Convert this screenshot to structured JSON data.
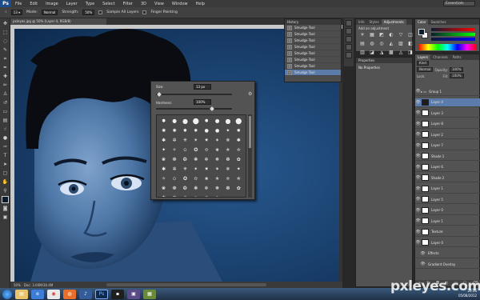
{
  "app": {
    "logo": "Ps"
  },
  "menu": [
    "File",
    "Edit",
    "Image",
    "Layer",
    "Type",
    "Select",
    "Filter",
    "3D",
    "View",
    "Window",
    "Help"
  ],
  "workspace": "Essentials",
  "options_bar": {
    "mode_label": "Mode:",
    "mode_value": "Normal",
    "strength_label": "Strength:",
    "strength_value": "50%",
    "sample_all": "Sample All Layers",
    "finger_painting": "Finger Painting"
  },
  "document": {
    "tab_title": "pxleyes.jpg @ 50% (Layer 4, RGB/8)",
    "zoom": "50%",
    "doc_info": "Doc: 3.00M/30.4M"
  },
  "brush_popup": {
    "size_label": "Size:",
    "size_value": "13 px",
    "hardness_label": "Hardness:",
    "hardness_value": "100%"
  },
  "brush_presets": [
    "●",
    "●",
    "●",
    "●",
    "●",
    "●",
    "●",
    "●",
    "✺",
    "✺",
    "✹",
    "✸",
    "●",
    "●",
    "✦",
    "✹",
    "✱",
    "✲",
    "✳",
    "✴",
    "✷",
    "✶",
    "✵",
    "✱",
    "✦",
    "✧",
    "✩",
    "✪",
    "✫",
    "✬",
    "✭",
    "✮",
    "❀",
    "❁",
    "❂",
    "❃",
    "❄",
    "❅",
    "❆",
    "✿",
    "✱",
    "✲",
    "✳",
    "✴",
    "✷",
    "✶",
    "✵",
    "✦",
    "✧",
    "✩",
    "✪",
    "✫",
    "✬",
    "✭",
    "✮",
    "✯",
    "❀",
    "❁",
    "❂",
    "❃",
    "❄",
    "❅",
    "❆",
    "✿",
    "✱",
    "✲",
    "✳",
    "✴",
    "✷",
    "✶"
  ],
  "history": {
    "title": "History",
    "items": [
      "Smudge Tool",
      "Smudge Tool",
      "Smudge Tool",
      "Smudge Tool",
      "Smudge Tool",
      "Smudge Tool",
      "Smudge Tool",
      "Smudge Tool"
    ]
  },
  "adjustments": {
    "tabs": [
      "Info",
      "Styles",
      "Adjustments"
    ],
    "title": "Add an adjustment",
    "icons": [
      "☀",
      "▦",
      "◩",
      "◐",
      "▽",
      "◫",
      "▤",
      "◍",
      "◎",
      "◭",
      "▨",
      "◧",
      "▥",
      "◪",
      "◮",
      "▩",
      "◬",
      "◨"
    ]
  },
  "properties": {
    "title": "Properties",
    "subtitle": "No Properties"
  },
  "color_panel": {
    "tabs": [
      "Color",
      "Swatches"
    ],
    "fg": "#0b1c2e",
    "bg": "#ffffff"
  },
  "layers_panel": {
    "tabs": [
      "Layers",
      "Channels",
      "Paths"
    ],
    "kind_label": "Kind",
    "blend": "Normal",
    "opacity_label": "Opacity:",
    "opacity": "100%",
    "lock_label": "Lock:",
    "fill_label": "Fill:",
    "fill": "100%",
    "rows": [
      {
        "name": "Group 1",
        "thumb": "group"
      },
      {
        "name": "Layer 4",
        "thumb": "dark"
      },
      {
        "name": "Layer 3",
        "thumb": "white"
      },
      {
        "name": "Layer 8",
        "thumb": "white"
      },
      {
        "name": "Layer 2",
        "thumb": "white"
      },
      {
        "name": "Layer 7",
        "thumb": "white"
      },
      {
        "name": "Shade 1",
        "thumb": "white"
      },
      {
        "name": "Layer 6",
        "thumb": "white"
      },
      {
        "name": "Shade 2",
        "thumb": "white"
      },
      {
        "name": "Layer 1",
        "thumb": "white"
      },
      {
        "name": "Layer 5",
        "thumb": "white"
      },
      {
        "name": "Layer 0",
        "thumb": "white"
      },
      {
        "name": "Layer 1",
        "thumb": "white"
      },
      {
        "name": "Texture",
        "thumb": "white"
      },
      {
        "name": "Layer 0",
        "thumb": "white"
      },
      {
        "name": "Effects",
        "thumb": "none"
      },
      {
        "name": "Gradient Overlay",
        "thumb": "none"
      }
    ]
  },
  "taskbar": {
    "time": "20:56",
    "date": "05/08/2012"
  },
  "watermark": "pxleyes.com"
}
